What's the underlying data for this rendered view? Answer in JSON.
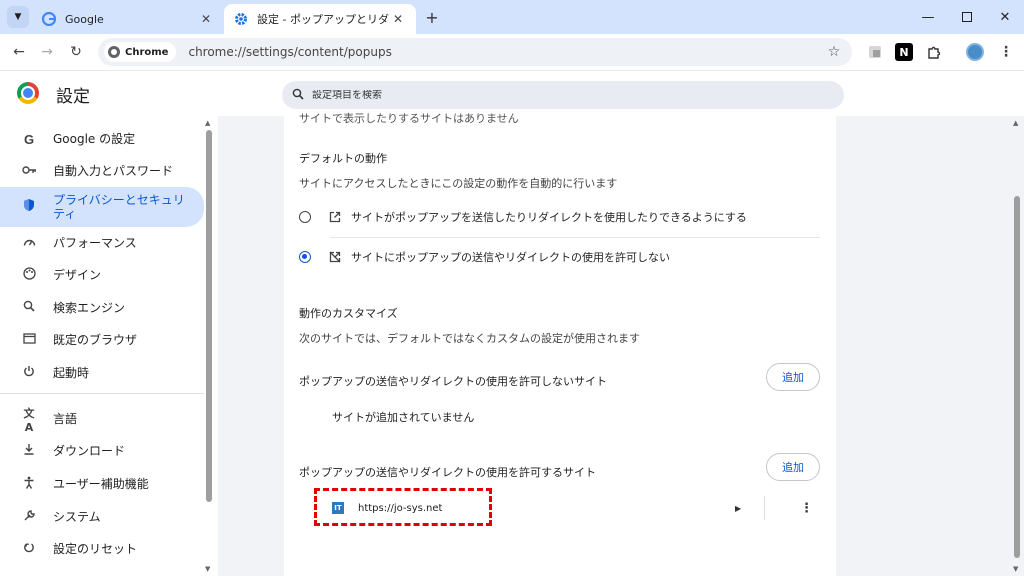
{
  "tabs": [
    {
      "title": "Google",
      "favicon": "google-g-icon",
      "active": false
    },
    {
      "title": "設定 - ポップアップとリダイレクト",
      "favicon": "gear-icon",
      "active": true
    }
  ],
  "toolbar": {
    "chip_label": "Chrome",
    "url": "chrome://settings/content/popups"
  },
  "header": {
    "title": "設定",
    "search_placeholder": "設定項目を検索"
  },
  "sidebar": {
    "items": [
      {
        "label": "Google の設定",
        "icon": "google-g-icon"
      },
      {
        "label": "自動入力とパスワード",
        "icon": "key-icon"
      },
      {
        "label": "プライバシーとセキュリティ",
        "icon": "shield-icon",
        "active": true
      },
      {
        "label": "パフォーマンス",
        "icon": "gauge-icon"
      },
      {
        "label": "デザイン",
        "icon": "palette-icon"
      },
      {
        "label": "検索エンジン",
        "icon": "search-icon"
      },
      {
        "label": "既定のブラウザ",
        "icon": "browser-window-icon"
      },
      {
        "label": "起動時",
        "icon": "power-icon"
      },
      {
        "label": "言語",
        "icon": "translate-icon"
      },
      {
        "label": "ダウンロード",
        "icon": "download-icon"
      },
      {
        "label": "ユーザー補助機能",
        "icon": "accessibility-icon"
      },
      {
        "label": "システム",
        "icon": "wrench-icon"
      },
      {
        "label": "設定のリセット",
        "icon": "reset-icon"
      }
    ]
  },
  "content": {
    "cut_text": "サイトで表示したりするサイトはありません",
    "default_behavior": {
      "heading": "デフォルトの動作",
      "description": "サイトにアクセスしたときにこの設定の動作を自動的に行います",
      "options": [
        {
          "label": "サイトがポップアップを送信したりリダイレクトを使用したりできるようにする",
          "checked": false
        },
        {
          "label": "サイトにポップアップの送信やリダイレクトの使用を許可しない",
          "checked": true
        }
      ]
    },
    "custom_behavior": {
      "heading": "動作のカスタマイズ",
      "description": "次のサイトでは、デフォルトではなくカスタムの設定が使用されます"
    },
    "block_list": {
      "heading": "ポップアップの送信やリダイレクトの使用を許可しないサイト",
      "add_label": "追加",
      "empty_text": "サイトが追加されていません"
    },
    "allow_list": {
      "heading": "ポップアップの送信やリダイレクトの使用を許可するサイト",
      "add_label": "追加",
      "sites": [
        {
          "url": "https://jo-sys.net",
          "favicon_text": "IT"
        }
      ]
    }
  },
  "colors": {
    "accent": "#0b57d0",
    "active_nav_bg": "#d3e3fd",
    "highlight": "#e00000"
  }
}
